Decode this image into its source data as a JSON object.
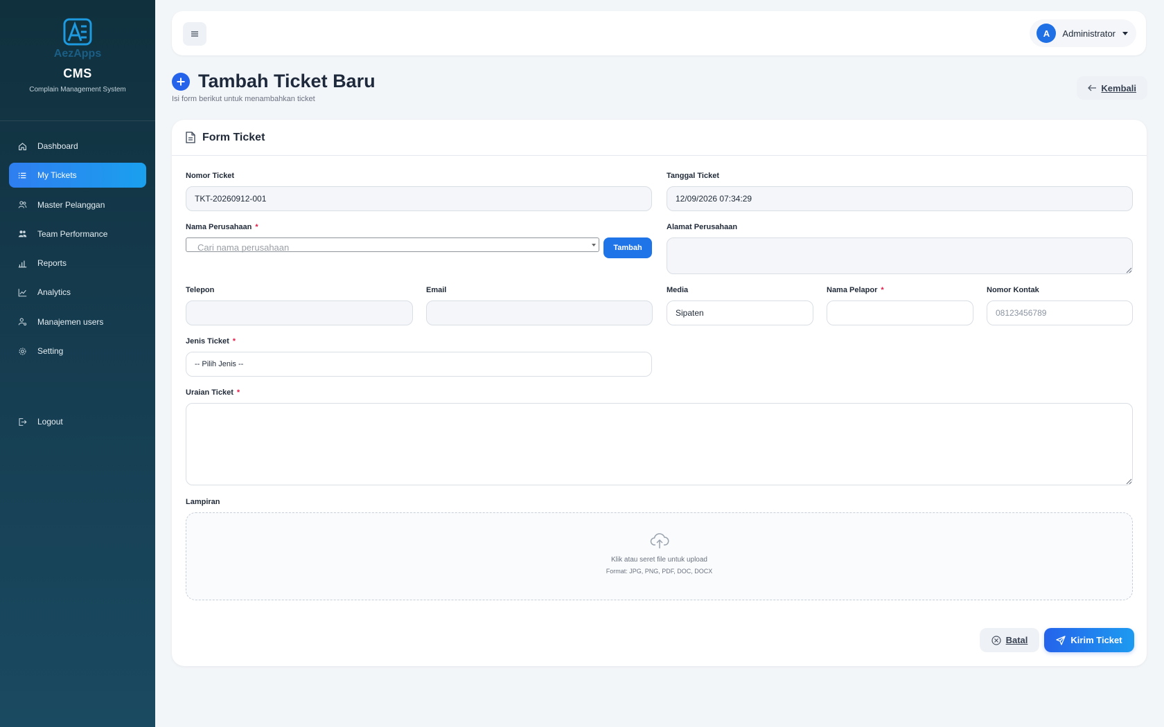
{
  "brand": {
    "logo_text": "AezApps",
    "name": "CMS",
    "subtitle": "Complain Management System"
  },
  "sidebar": {
    "items": [
      {
        "label": "Dashboard",
        "icon": "home-icon",
        "active": false
      },
      {
        "label": "My Tickets",
        "icon": "list-icon",
        "active": true
      },
      {
        "label": "Master Pelanggan",
        "icon": "users-icon",
        "active": false
      },
      {
        "label": "Team Performance",
        "icon": "team-icon",
        "active": false
      },
      {
        "label": "Reports",
        "icon": "bar-chart-icon",
        "active": false
      },
      {
        "label": "Analytics",
        "icon": "line-chart-icon",
        "active": false
      },
      {
        "label": "Manajemen users",
        "icon": "user-gear-icon",
        "active": false
      },
      {
        "label": "Setting",
        "icon": "gear-icon",
        "active": false
      }
    ],
    "logout": {
      "label": "Logout",
      "icon": "logout-icon"
    }
  },
  "topbar": {
    "menu_icon": "hamburger-icon",
    "user_initial": "A",
    "user_name": "Administrator"
  },
  "page": {
    "title": "Tambah Ticket Baru",
    "subtitle": "Isi form berikut untuk menambahkan ticket",
    "back_label": "Kembali"
  },
  "form": {
    "card_title": "Form Ticket",
    "nomor_ticket": {
      "label": "Nomor Ticket",
      "value": "TKT-20260912-001"
    },
    "tanggal_ticket": {
      "label": "Tanggal Ticket",
      "value": "12/09/2026 07:34:29"
    },
    "nama_perusahaan": {
      "label": "Nama Perusahaan",
      "required": "*",
      "placeholder": "Cari nama perusahaan",
      "add_label": "Tambah"
    },
    "alamat_perusahaan": {
      "label": "Alamat Perusahaan",
      "value": ""
    },
    "telepon": {
      "label": "Telepon",
      "value": ""
    },
    "email": {
      "label": "Email",
      "value": ""
    },
    "media": {
      "label": "Media",
      "value": "Sipaten"
    },
    "nama_pelapor": {
      "label": "Nama Pelapor",
      "required": "*",
      "value": ""
    },
    "nomor_kontak": {
      "label": "Nomor Kontak",
      "placeholder": "08123456789"
    },
    "jenis_ticket": {
      "label": "Jenis Ticket",
      "required": "*",
      "selected": "-- Pilih Jenis --"
    },
    "uraian_ticket": {
      "label": "Uraian Ticket",
      "required": "*",
      "value": ""
    },
    "lampiran": {
      "label": "Lampiran",
      "upload_text": "Klik atau seret file untuk upload",
      "formats": "Format: JPG, PNG, PDF, DOC, DOCX"
    },
    "cancel_label": "Batal",
    "submit_label": "Kirim Ticket"
  },
  "colors": {
    "primary": "#2563eb",
    "sidebar_bg": "#10303d",
    "required": "#e11d48"
  }
}
